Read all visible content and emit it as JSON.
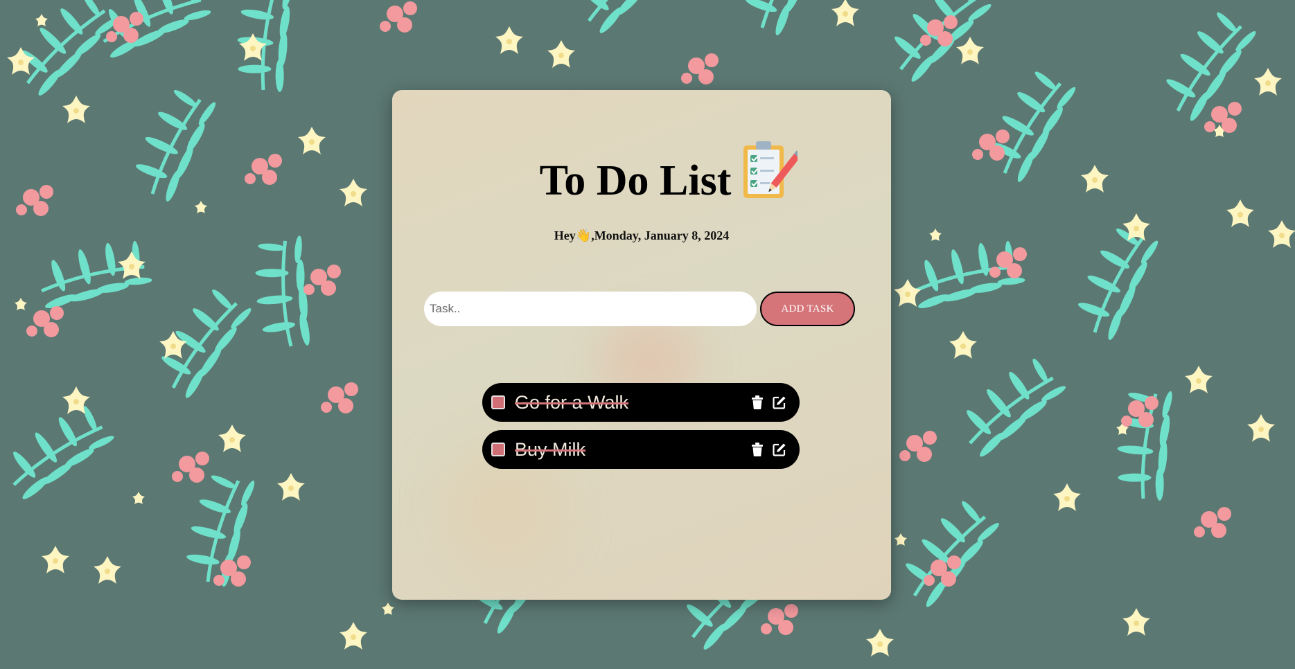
{
  "header": {
    "title": "To Do List",
    "greeting": "Hey",
    "wave_icon": "waving-hand-icon",
    "date": ",Monday, January 8, 2024",
    "title_icon": "clipboard-checklist-icon"
  },
  "form": {
    "placeholder": "Task..",
    "value": "",
    "add_label": "ADD TASK"
  },
  "tasks": [
    {
      "text": "Go for a Walk",
      "completed": true
    },
    {
      "text": "Buy Milk",
      "completed": true
    }
  ],
  "colors": {
    "accent": "#d5757a",
    "background": "#5c7873",
    "card": "#e0d7c0",
    "leaf": "#6fe0c9",
    "flower": "#fef6c2",
    "berry": "#f29a9e"
  }
}
